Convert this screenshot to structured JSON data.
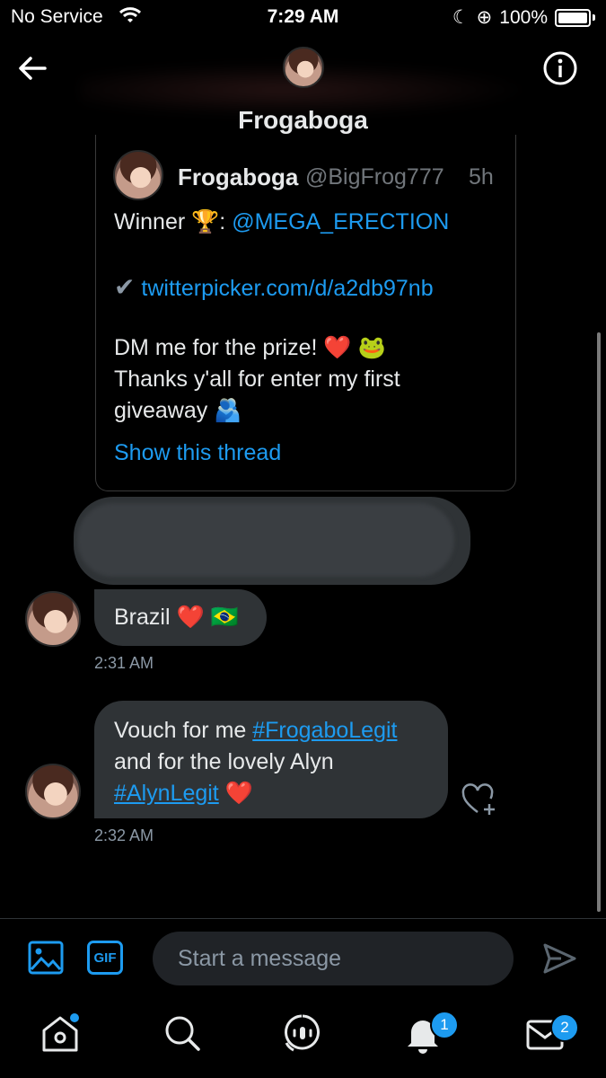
{
  "status_bar": {
    "carrier": "No Service",
    "time": "7:29 AM",
    "battery": "100%"
  },
  "header": {
    "title": "Frogaboga"
  },
  "quoted_tweet": {
    "author": "Frogaboga",
    "handle": "@BigFrog777",
    "time": "5h",
    "winner_label": "Winner",
    "winner_emoji": "🏆",
    "winner_handle": "@MEGA_ERECTION",
    "check_icon": "✔",
    "link": "twitterpicker.com/d/a2db97nb",
    "line1": "DM me for the prize!",
    "line1_emoji": "❤️ 🐸",
    "line2": "Thanks y'all for enter my first",
    "line3": "giveaway",
    "line3_emoji": "🫂",
    "show_thread": "Show this thread"
  },
  "messages": [
    {
      "text": "Brazil",
      "emoji": "❤️ 🇧🇷",
      "timestamp": "2:31 AM"
    },
    {
      "line1_text": "Vouch for me ",
      "hashtag1": "#FrogaboLegit",
      "line2_text": "and for the lovely Alyn",
      "hashtag2": "#AlynLegit",
      "emoji": "❤️",
      "timestamp": "2:32 AM"
    }
  ],
  "composer": {
    "placeholder": "Start a message",
    "gif_label": "GIF"
  },
  "tabbar": {
    "notifications_badge": "1",
    "messages_badge": "2"
  },
  "colors": {
    "accent": "#1d9bf0",
    "bubble": "#2f3336",
    "background": "#000000"
  }
}
